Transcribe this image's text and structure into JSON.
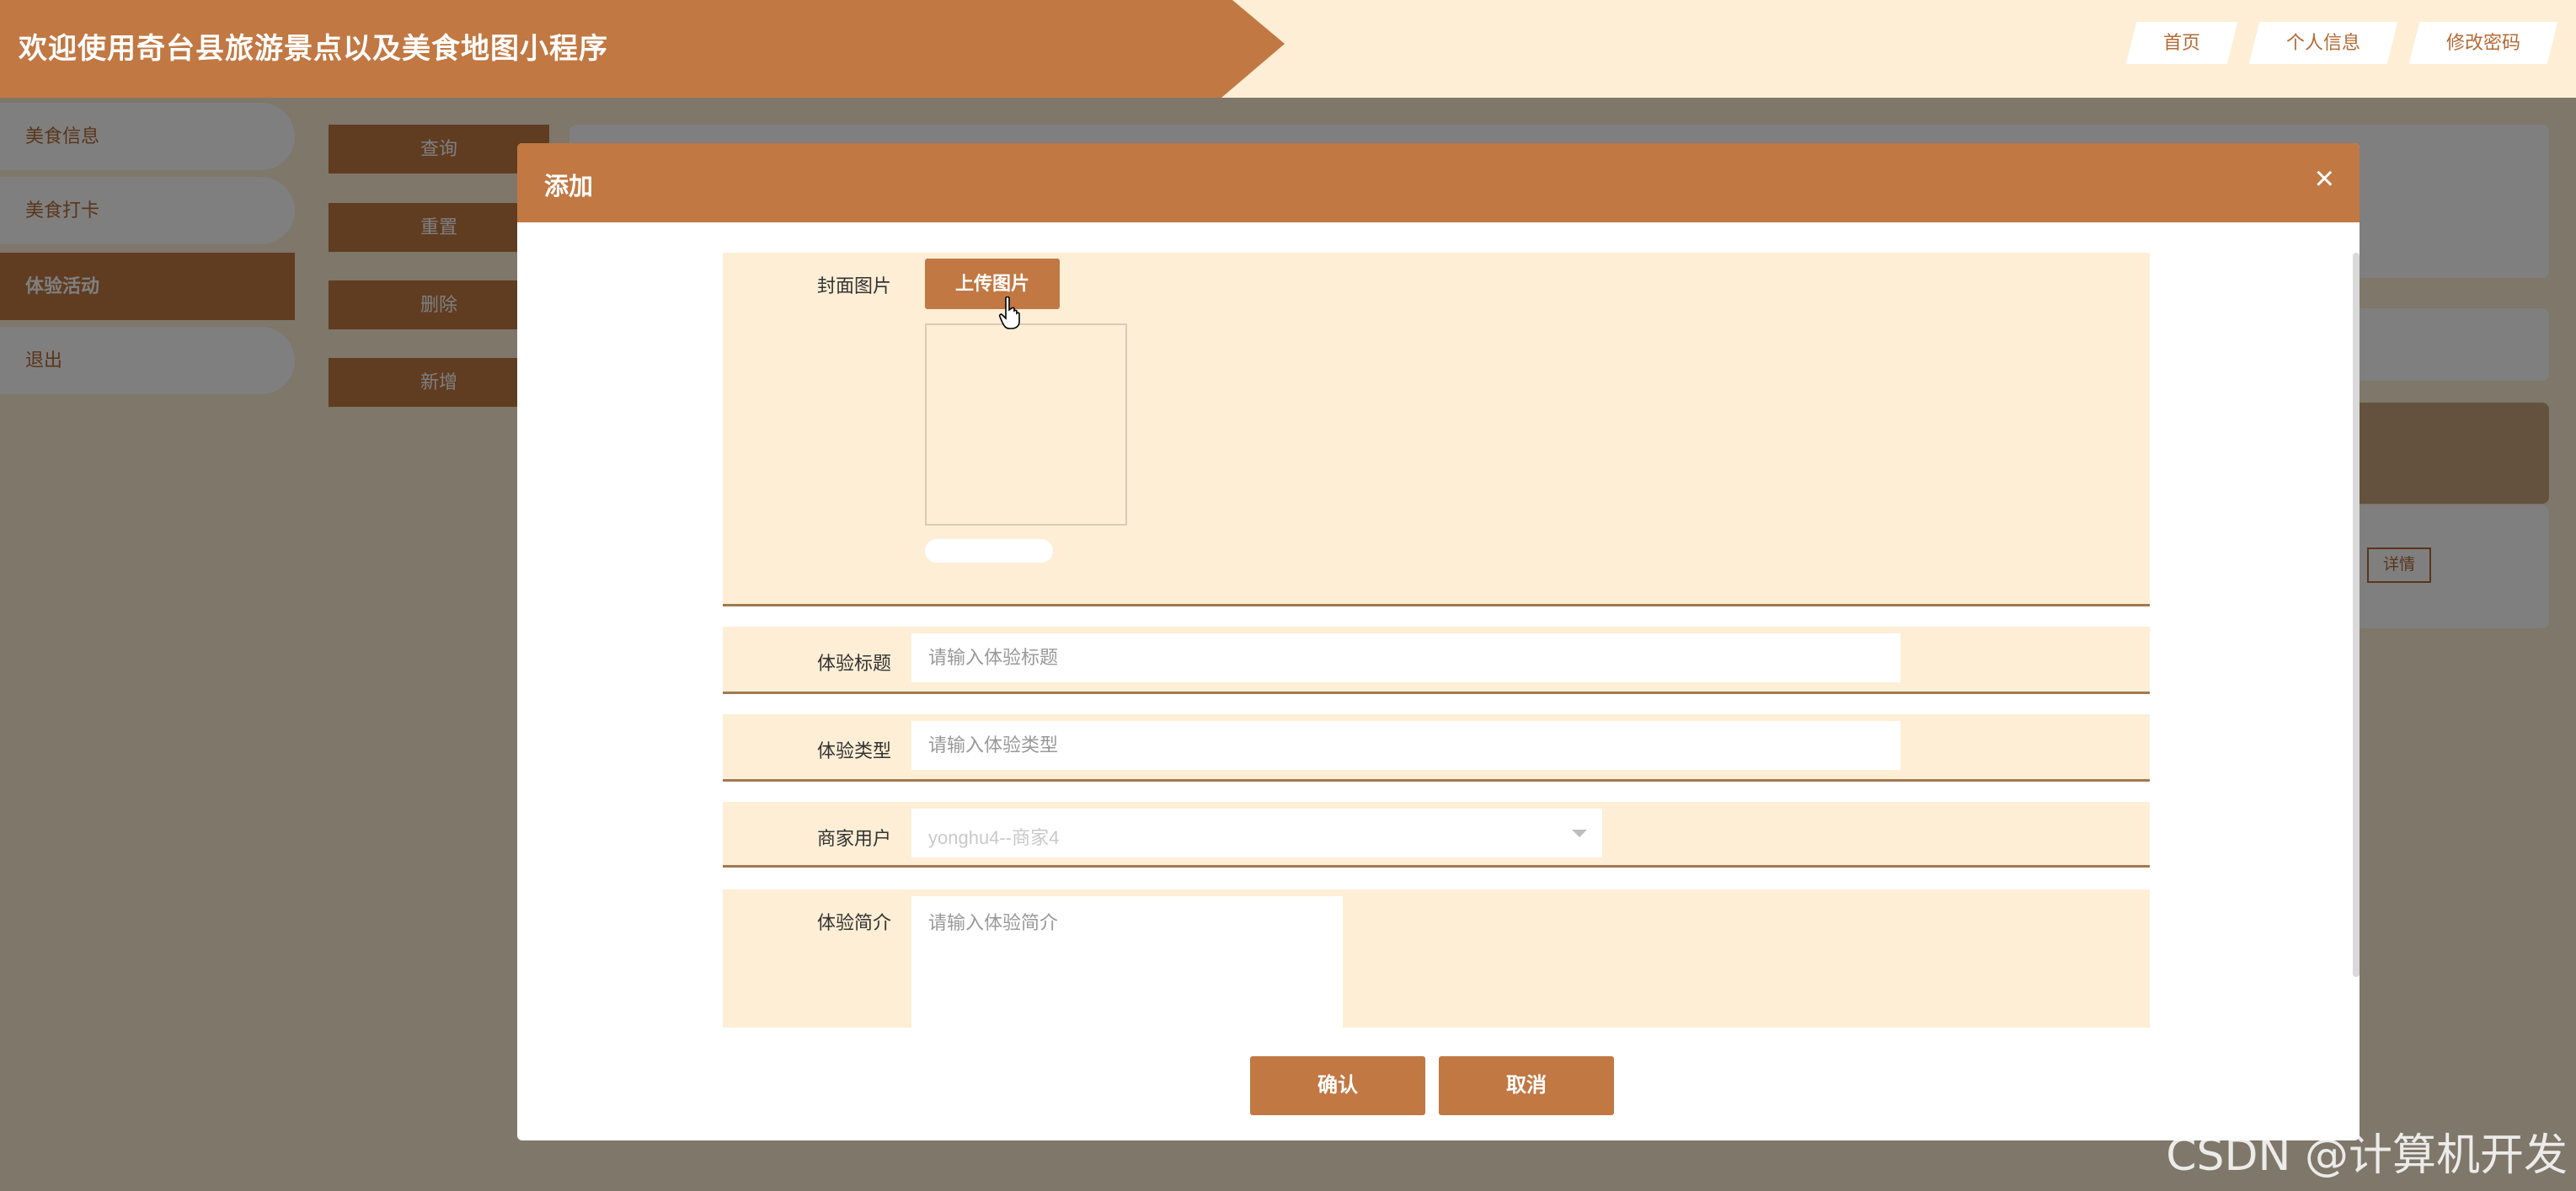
{
  "header": {
    "title": "欢迎使用奇台县旅游景点以及美食地图小程序",
    "nav": [
      "首页",
      "个人信息",
      "修改密码"
    ]
  },
  "sidebar": {
    "items": [
      {
        "label": "美食信息"
      },
      {
        "label": "美食打卡"
      },
      {
        "label": "体验活动"
      },
      {
        "label": "退出"
      }
    ]
  },
  "actions": [
    "查询",
    "重置",
    "删除",
    "新增"
  ],
  "table": {
    "detail_button": "详情"
  },
  "modal": {
    "title": "添加",
    "close": "×",
    "fields": {
      "cover_label": "封面图片",
      "upload_button": "上传图片",
      "title_label": "体验标题",
      "title_placeholder": "请输入体验标题",
      "type_label": "体验类型",
      "type_placeholder": "请输入体验类型",
      "merchant_label": "商家用户",
      "merchant_value": "yonghu4--商家4",
      "intro_label": "体验简介",
      "intro_placeholder": "请输入体验简介"
    },
    "confirm": "确认",
    "cancel": "取消"
  },
  "watermark": "CSDN @计算机开发",
  "colors": {
    "accent": "#c17843",
    "page_bg": "#fdeed5",
    "form_border": "#a2784f"
  }
}
